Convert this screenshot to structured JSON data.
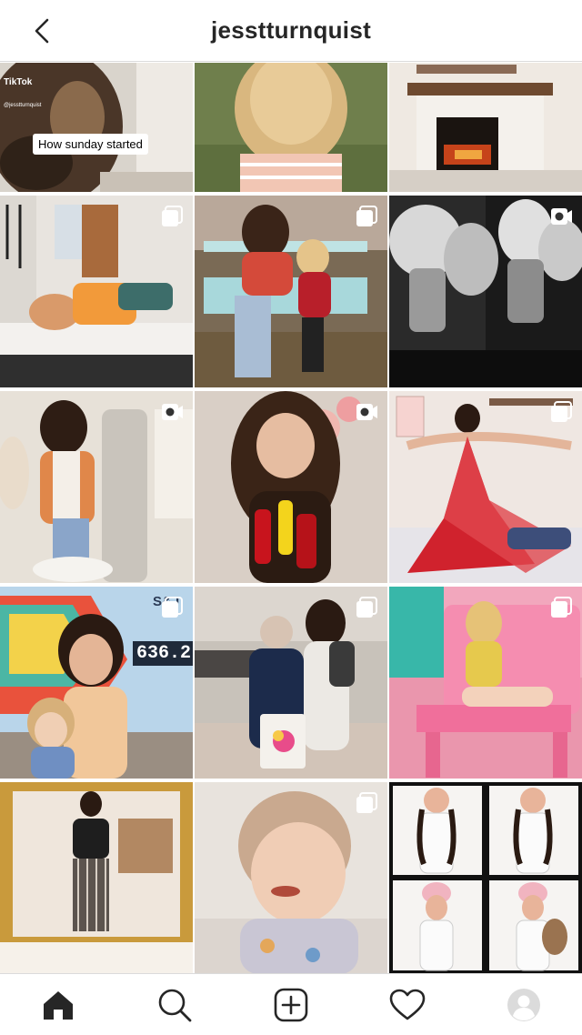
{
  "header": {
    "title": "jesstturnquist",
    "back_icon": "chevron-left-icon"
  },
  "grid": {
    "posts": [
      {
        "type": "reel",
        "caption": "How sunday started",
        "source_label": "TikTok",
        "handle": "@jesstturnquist"
      },
      {
        "type": "photo"
      },
      {
        "type": "photo"
      },
      {
        "type": "carousel",
        "badge_icon": "carousel-icon"
      },
      {
        "type": "carousel",
        "badge_icon": "carousel-icon"
      },
      {
        "type": "video",
        "badge_icon": "video-icon"
      },
      {
        "type": "video",
        "badge_icon": "video-icon"
      },
      {
        "type": "video",
        "badge_icon": "video-icon"
      },
      {
        "type": "carousel",
        "badge_icon": "carousel-icon"
      },
      {
        "type": "carousel",
        "badge_icon": "carousel-icon",
        "sign_text": "636.2",
        "sign_small": "S&J"
      },
      {
        "type": "carousel",
        "badge_icon": "carousel-icon"
      },
      {
        "type": "carousel",
        "badge_icon": "carousel-icon"
      },
      {
        "type": "photo"
      },
      {
        "type": "carousel",
        "badge_icon": "carousel-icon"
      },
      {
        "type": "photo"
      }
    ]
  },
  "tabbar": {
    "items": [
      {
        "name": "home",
        "icon": "home-icon",
        "active": true
      },
      {
        "name": "search",
        "icon": "search-icon"
      },
      {
        "name": "new-post",
        "icon": "add-post-icon"
      },
      {
        "name": "activity",
        "icon": "heart-icon"
      },
      {
        "name": "profile",
        "icon": "avatar-icon"
      }
    ]
  },
  "colors": {
    "text": "#262626",
    "divider": "#dbdbdb",
    "background": "#ffffff"
  }
}
